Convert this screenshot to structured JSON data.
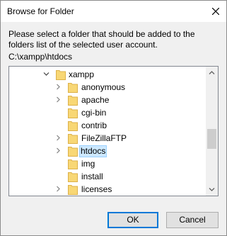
{
  "window": {
    "title": "Browse for Folder",
    "close_glyph": "close-icon"
  },
  "description": "Please select a folder that should be added to the folders list of the selected user account.",
  "current_path": "C:\\xampp\\htdocs",
  "tree": {
    "items": [
      {
        "label": "xampp",
        "expander": "expanded",
        "selected": false
      },
      {
        "label": "anonymous",
        "expander": "collapsed",
        "selected": false
      },
      {
        "label": "apache",
        "expander": "collapsed",
        "selected": false
      },
      {
        "label": "cgi-bin",
        "expander": "none",
        "selected": false
      },
      {
        "label": "contrib",
        "expander": "none",
        "selected": false
      },
      {
        "label": "FileZillaFTP",
        "expander": "collapsed",
        "selected": false
      },
      {
        "label": "htdocs",
        "expander": "collapsed",
        "selected": true
      },
      {
        "label": "img",
        "expander": "none",
        "selected": false
      },
      {
        "label": "install",
        "expander": "none",
        "selected": false
      },
      {
        "label": "licenses",
        "expander": "collapsed",
        "selected": false
      }
    ]
  },
  "buttons": {
    "ok": "OK",
    "cancel": "Cancel"
  },
  "colors": {
    "selection_fill": "#cce8ff",
    "selection_border": "#99d1ff",
    "folder_yellow": "#f8d775",
    "default_button_border": "#0078d7"
  }
}
